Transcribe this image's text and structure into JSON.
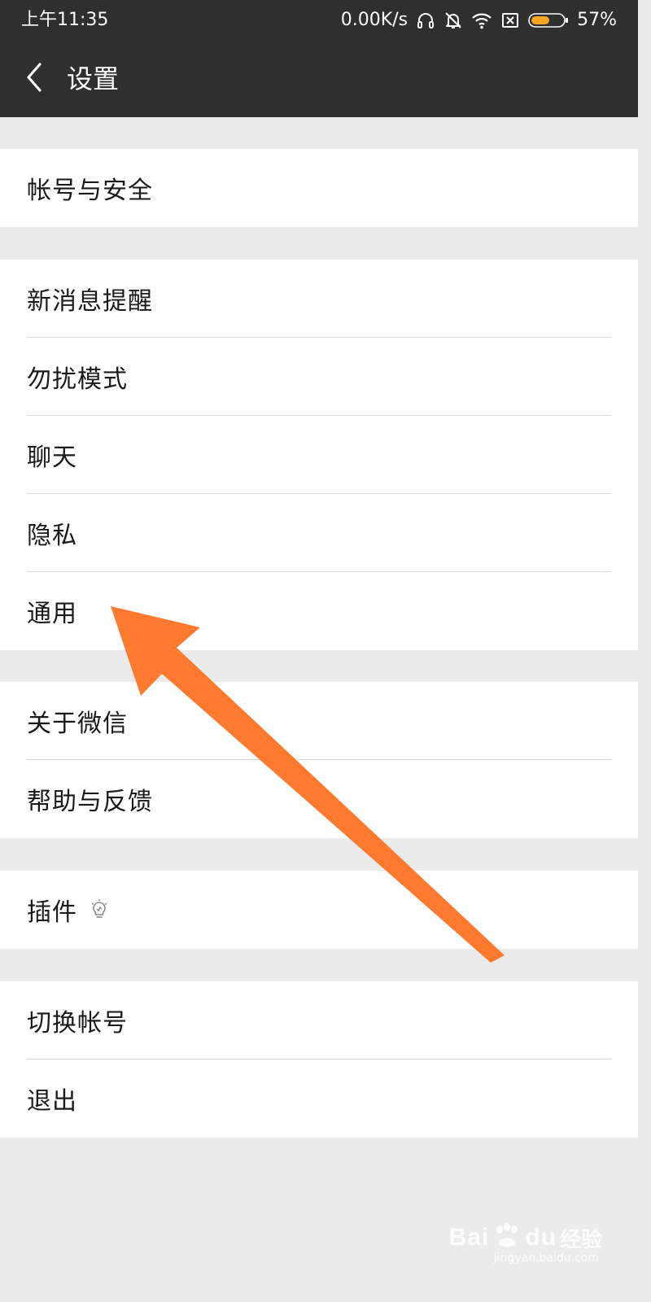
{
  "status_bar": {
    "time": "上午11:35",
    "net_speed": "0.00K/s",
    "battery_percent": "57%",
    "battery_level": 0.57,
    "battery_color": "#f5a623",
    "icons": [
      "headphones-icon",
      "mute-icon",
      "wifi-icon",
      "no-sim-icon",
      "battery-icon"
    ]
  },
  "nav": {
    "back_icon": "chevron-left-icon",
    "title": "设置"
  },
  "groups": [
    {
      "items": [
        "帐号与安全"
      ]
    },
    {
      "items": [
        "新消息提醒",
        "勿扰模式",
        "聊天",
        "隐私",
        "通用"
      ]
    },
    {
      "items": [
        "关于微信",
        "帮助与反馈"
      ]
    },
    {
      "items": [
        "插件"
      ]
    },
    {
      "items": [
        "切换帐号",
        "退出"
      ]
    }
  ],
  "plugin_icon": "lightbulb-icon",
  "annotation": {
    "type": "arrow",
    "color": "#ff7a2e",
    "points_to": "通用"
  },
  "watermark": {
    "brand": "Bai",
    "brand2": "du",
    "product": "经验",
    "url": "jingyan.baidu.com"
  }
}
